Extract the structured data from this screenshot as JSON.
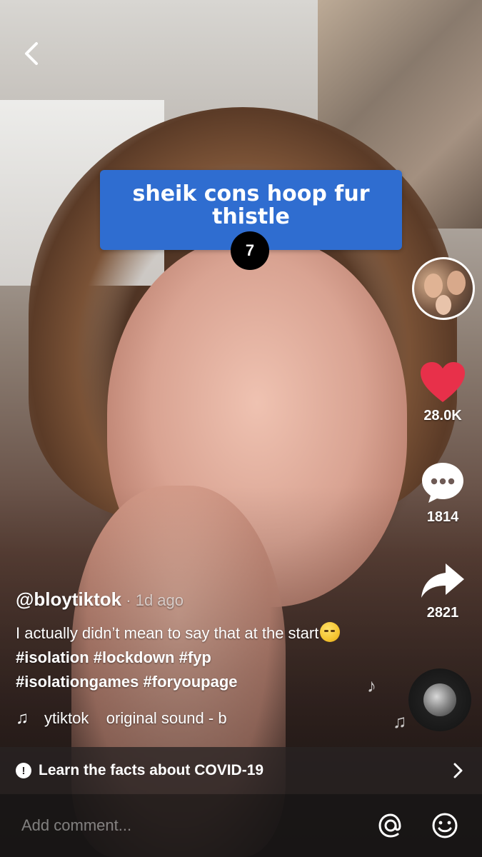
{
  "question": {
    "text": "sheik cons hoop fur thistle",
    "counter": "7"
  },
  "rail": {
    "like_count": "28.0K",
    "comment_count": "1814",
    "share_count": "2821"
  },
  "post": {
    "username": "@bloytiktok",
    "timestamp": " · 1d ago",
    "description": "I actually didn’t mean to say that at the start",
    "hashtags_line1": [
      " #isolation",
      " #lockdown",
      " #fyp"
    ],
    "hashtags_line2": [
      "#isolationgames",
      " #foryoupage"
    ]
  },
  "sound": {
    "text": "ytiktok    original sound - b"
  },
  "banner": {
    "text": "Learn the facts about COVID-19"
  },
  "comment_bar": {
    "placeholder": "Add comment..."
  },
  "icons": {
    "back": "chevron-left-icon",
    "like": "heart-icon",
    "comment": "chat-bubble-icon",
    "share": "share-arrow-icon",
    "music": "music-note-icon",
    "info": "exclamation-circle-icon",
    "chevron": "chevron-right-icon",
    "mention": "at-sign-icon",
    "emoji": "smiley-icon"
  },
  "colors": {
    "question_card": "#2f6dd0",
    "like_heart": "#e8304a"
  }
}
